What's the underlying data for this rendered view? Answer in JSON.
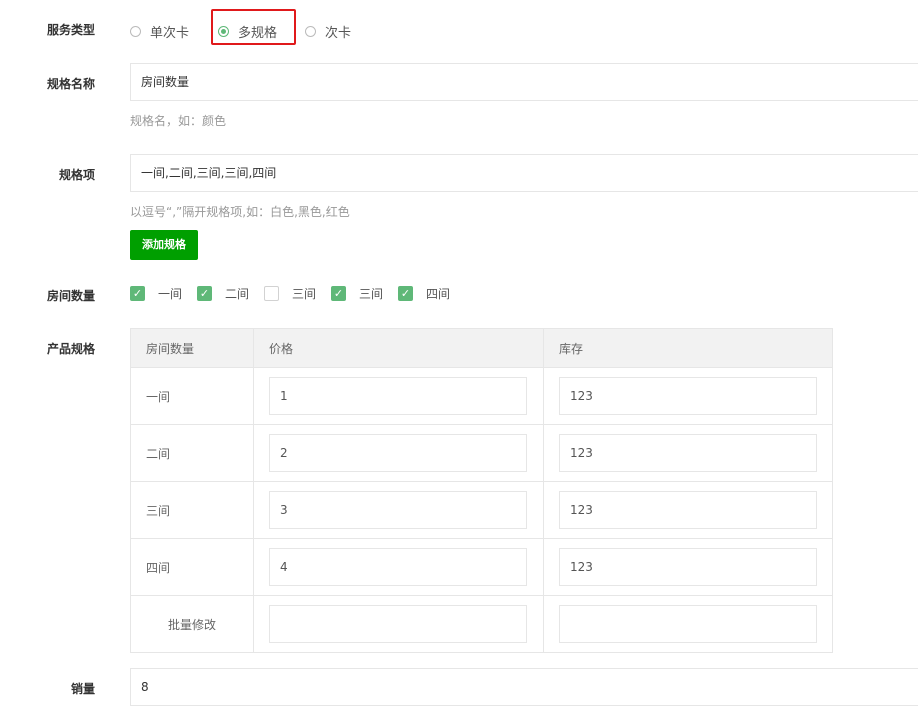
{
  "service_type": {
    "label": "服务类型",
    "options": [
      {
        "label": "单次卡",
        "selected": false
      },
      {
        "label": "多规格",
        "selected": true
      },
      {
        "label": "次卡",
        "selected": false
      }
    ]
  },
  "spec_name": {
    "label": "规格名称",
    "value": "房间数量",
    "hint": "规格名，如：颜色"
  },
  "spec_items": {
    "label": "规格项",
    "value": "一间,二间,三间,三间,四间",
    "hint": "以逗号“,”隔开规格项,如：白色,黑色,红色"
  },
  "add_spec_button": "添加规格",
  "room_count": {
    "label": "房间数量",
    "options": [
      {
        "label": "一间",
        "checked": true
      },
      {
        "label": "二间",
        "checked": true
      },
      {
        "label": "三间",
        "checked": false
      },
      {
        "label": "三间",
        "checked": true
      },
      {
        "label": "四间",
        "checked": true
      }
    ]
  },
  "product_spec": {
    "label": "产品规格",
    "headers": [
      "房间数量",
      "价格",
      "库存"
    ],
    "rows": [
      {
        "name": "一间",
        "price": "1",
        "stock": "123"
      },
      {
        "name": "二间",
        "price": "2",
        "stock": "123"
      },
      {
        "name": "三间",
        "price": "3",
        "stock": "123"
      },
      {
        "name": "四间",
        "price": "4",
        "stock": "123"
      }
    ],
    "batch_label": "批量修改",
    "batch_price": "",
    "batch_stock": ""
  },
  "sales": {
    "label": "销量",
    "value": "8"
  },
  "colors": {
    "accent_green": "#5fb878",
    "button_green": "#009f00",
    "highlight_red": "#e0191b"
  }
}
